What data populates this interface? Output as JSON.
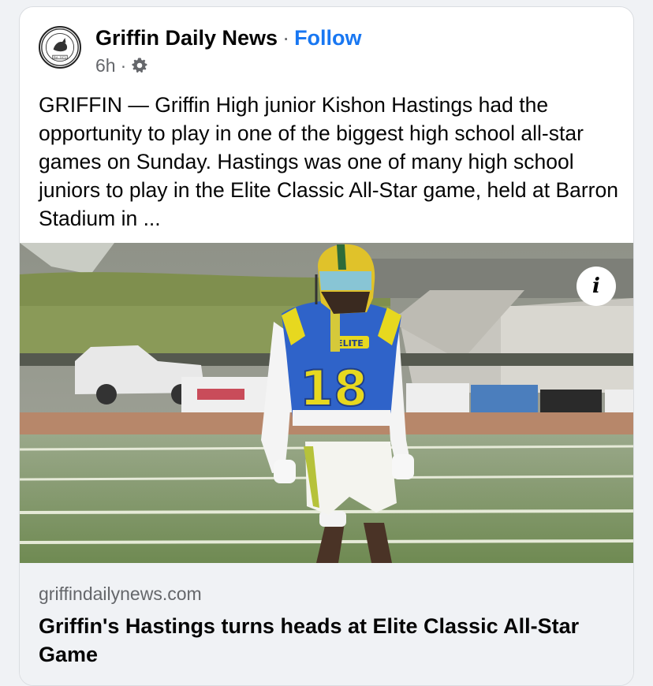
{
  "post": {
    "page_name": "Griffin Daily News",
    "separator": "·",
    "follow_label": "Follow",
    "timestamp": "6h",
    "meta_separator": "·",
    "audience_icon": "gear-icon",
    "avatar_caption": "Est. 1872",
    "text": "GRIFFIN — Griffin High junior Kishon Hastings had the opportunity to play in one of the biggest high school all-star games on Sunday. Hastings was one of many high school juniors to play in the Elite Classic All-Star game, held at Barron Stadium in ..."
  },
  "photo": {
    "jersey_number": "18",
    "jersey_text": "ELITE",
    "info_label": "i"
  },
  "link": {
    "domain": "griffindailynews.com",
    "title": "Griffin's Hastings turns heads at Elite Classic All-Star Game"
  }
}
